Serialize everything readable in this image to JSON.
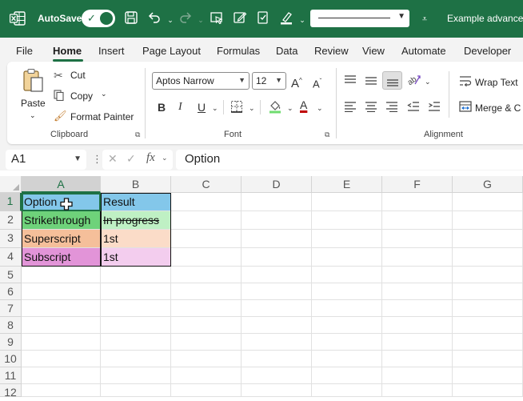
{
  "titlebar": {
    "autosave_label": "AutoSave",
    "document_title": "Example advanced",
    "accent": "#1e7145"
  },
  "menu": {
    "tabs": [
      "File",
      "Home",
      "Insert",
      "Page Layout",
      "Formulas",
      "Data",
      "Review",
      "View",
      "Automate",
      "Developer"
    ],
    "active": "Home"
  },
  "ribbon": {
    "clipboard": {
      "paste": "Paste",
      "cut": "Cut",
      "copy": "Copy",
      "format_painter": "Format Painter",
      "label": "Clipboard"
    },
    "font": {
      "font_name": "Aptos Narrow",
      "font_size": "12",
      "label": "Font",
      "bold": "B",
      "italic": "I",
      "underline": "U",
      "font_color": "A"
    },
    "alignment": {
      "wrap_text": "Wrap Text",
      "merge": "Merge & C",
      "label": "Alignment"
    }
  },
  "formula_bar": {
    "name_box": "A1",
    "fx": "fx",
    "content": "Option"
  },
  "sheet": {
    "columns": [
      "A",
      "B",
      "C",
      "D",
      "E",
      "F",
      "G"
    ],
    "rows": [
      "1",
      "2",
      "3",
      "4",
      "5",
      "6",
      "7",
      "8",
      "9",
      "10",
      "11",
      "12"
    ],
    "cells": {
      "A1": "Option",
      "B1": "Result",
      "A2": "Strikethrough",
      "B2": "In progress",
      "A3": "Superscript",
      "B3": "1st",
      "A4": "Subscript",
      "B4": "1st"
    },
    "colors": {
      "row1": "#83c7ea",
      "row1b": "#83c7ea",
      "row2a": "#6ed27a",
      "row2b": "#bff0c4",
      "row3a": "#f5bf9a",
      "row3b": "#fbdcc8",
      "row4a": "#e294d8",
      "row4b": "#f3cdee"
    }
  }
}
